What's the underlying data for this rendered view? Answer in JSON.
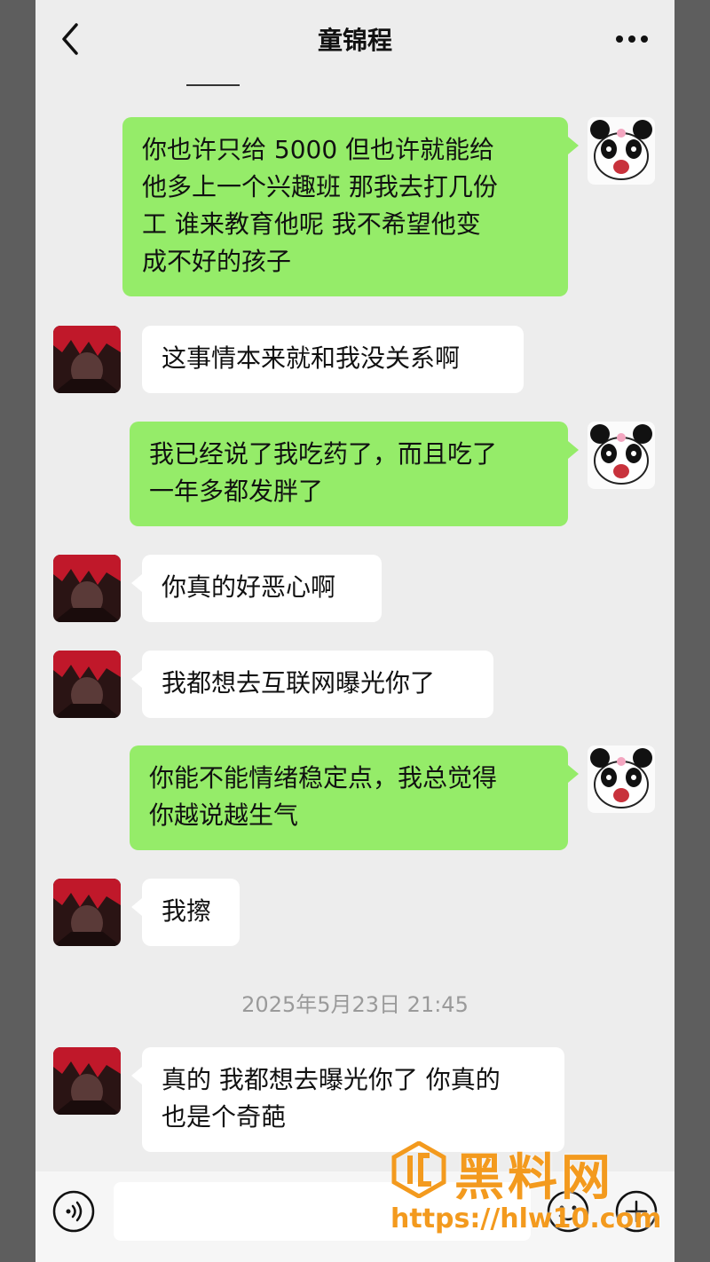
{
  "chat": {
    "title": "童锦程"
  },
  "messages": [
    {
      "sender": "self",
      "text": "你也许只给 5000 但也许就能给\n他多上一个兴趣班 那我去打几份\n工 谁来教育他呢 我不希望他变\n成不好的孩子"
    },
    {
      "sender": "other",
      "text": "这事情本来就和我没关系啊"
    },
    {
      "sender": "self",
      "text": "我已经说了我吃药了，而且吃了\n一年多都发胖了"
    },
    {
      "sender": "other",
      "text": "你真的好恶心啊"
    },
    {
      "sender": "other",
      "text": "我都想去互联网曝光你了"
    },
    {
      "sender": "self",
      "text": "你能不能情绪稳定点，我总觉得\n你越说越生气"
    },
    {
      "sender": "other",
      "text": "我擦"
    },
    {
      "sender": "other",
      "text": "真的 我都想去曝光你了 你真的\n也是个奇葩"
    }
  ],
  "timestamp": "2025年5月23日 21:45",
  "input": {
    "value": "",
    "placeholder": ""
  },
  "watermark": {
    "brand": "黑料网",
    "url": "https://hlw10.com"
  },
  "icons": {
    "back": "chevron-left-icon",
    "more": "more-dots-icon",
    "voice": "voice-icon",
    "emoji": "emoji-icon",
    "plus": "plus-icon"
  },
  "colors": {
    "self_bubble": "#95ec69",
    "other_bubble": "#ffffff",
    "background": "#ededed",
    "watermark": "#f39a1e"
  }
}
